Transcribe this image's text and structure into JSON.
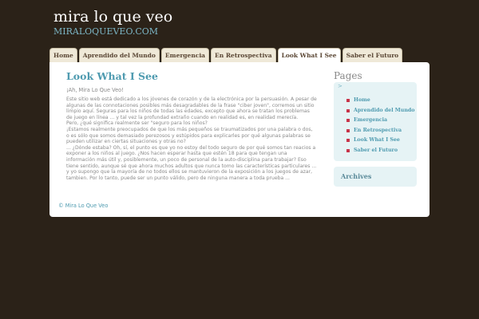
{
  "site": {
    "title": "mira lo que veo",
    "subtitle": "MIRALOQUEVEO.COM"
  },
  "nav": {
    "tabs": [
      {
        "label": "Home"
      },
      {
        "label": "Aprendido del Mundo"
      },
      {
        "label": "Emergencia"
      },
      {
        "label": "En Retrospectiva"
      },
      {
        "label": "Look What I See"
      },
      {
        "label": "Saber el Futuro"
      }
    ]
  },
  "post": {
    "title": "Look What I See",
    "subtitle": "¡Ah, Mira Lo Que Veo!",
    "paragraphs": [
      "Este sitio web está dedicado a los jóvenes de corazón y de la electrónica por la persuasión. A pesar de algunas de las connotaciones posibles más desagradables de la frase \"ciber joven\", corremos un sitio limpio aquí. Seguras para los niños de todas las edades, excepto que ahora se tratan los problemas de juego en línea ... y tal vez la profundad extraño cuando en realidad es, en realidad merecía.",
      "Pero, ¿qué significa realmente ser \"seguro para los niños?",
      "¡Estamos realmente preocupados de que los más pequeños se traumatizados por una palabra o dos, o es sólo que somos demasiado perezosos y estúpidos para explicarles por qué algunas palabras se pueden utilizar en ciertas situaciones y otras no?",
      "... ¿Dónde estaba? Oh, sí, el punto es que yo no estoy del todo seguro de por qué somos tan reacios a exponer a los niños al juego. ¿Nos hacen esperar hasta que estén 18 para que tengan una información más útil y, posiblemente, un poco de personal de la auto-disciplina para trabajar? Eso tiene sentido, aunque sé que ahora muchos adultos que nunca tomo las características particulares ... y yo supongo que la mayoría de no todos ellos se mantuvieron de la exposición a los juegos de azar, tambien. Por lo tanto, puede ser un punto válido, pero de ninguna manera a toda prueba ..."
    ]
  },
  "footer": {
    "link": "© Mira Lo Que Veo"
  },
  "sidebar": {
    "pages_heading": "Pages",
    "pages_arrow": ">",
    "pages": [
      {
        "label": "Home"
      },
      {
        "label": "Aprendido del Mundo"
      },
      {
        "label": "Emergencia"
      },
      {
        "label": "En Retrospectiva"
      },
      {
        "label": "Look What I See"
      },
      {
        "label": "Saber el Futuro"
      }
    ],
    "archives_heading": "Archives"
  },
  "colors": {
    "background": "#2b2218",
    "accent": "#4f9bb0",
    "bullet": "#c8344a",
    "sidebar_box": "#e6f3f5"
  }
}
